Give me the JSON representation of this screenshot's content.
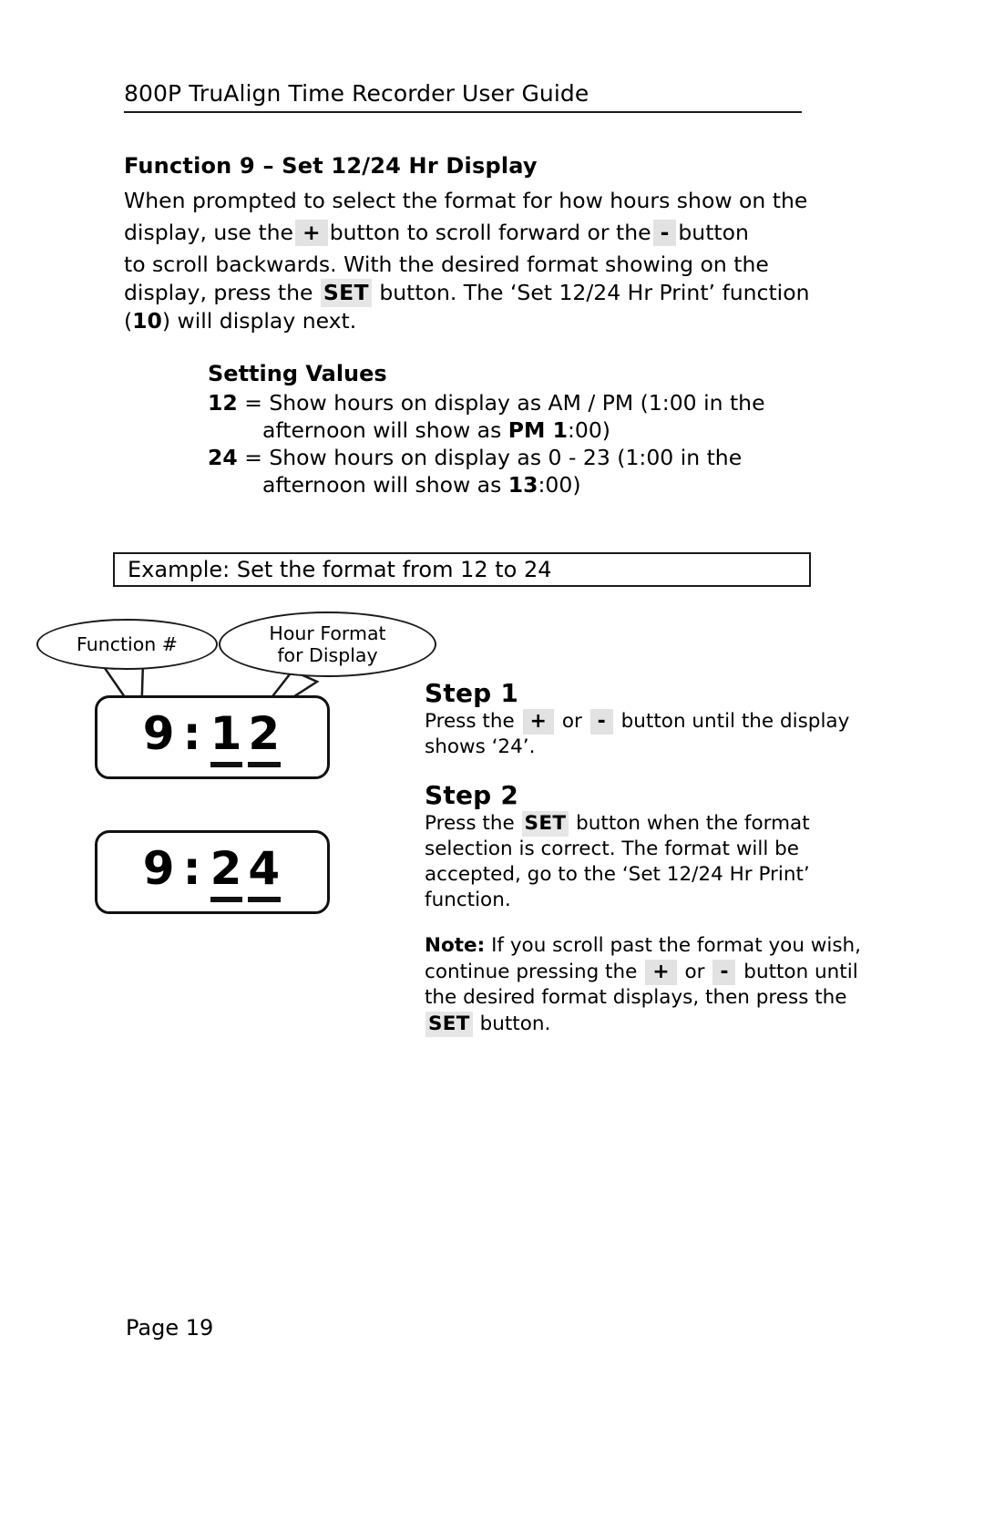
{
  "header": {
    "title": "800P TruAlign Time Recorder User Guide"
  },
  "function_section": {
    "heading": "Function 9 – Set 12/24 Hr Display",
    "intro_line1": "When prompted to select the format for how hours show on the",
    "intro_line2_a": "display, use the",
    "intro_key_plus": "+",
    "intro_line2_b": "button to scroll forward or the",
    "intro_key_minus": "-",
    "intro_line2_c": "button",
    "intro_line3": "to scroll backwards. With the desired format showing on the",
    "intro_line4_a": "display, press the",
    "intro_key_set": "SET",
    "intro_line4_b": "button. The ‘Set 12/24 Hr Print’ function",
    "intro_line5_a": "(",
    "intro_line5_num": "10",
    "intro_line5_b": ") will display next."
  },
  "setting_values": {
    "title": "Setting Values",
    "rows": [
      {
        "value": "12",
        "text": "= Show hours on display as AM / PM (1:00 in the",
        "cont_a": "afternoon will show as ",
        "cont_bold": "PM 1",
        "cont_b": ":00)"
      },
      {
        "value": "24",
        "text": "= Show hours on display as 0 - 23 (1:00 in the",
        "cont_a": "afternoon will show as ",
        "cont_bold": "13",
        "cont_b": ":00)"
      }
    ]
  },
  "example": {
    "label": "Example: Set the format from 12 to 24"
  },
  "callouts": {
    "function_number": "Function #",
    "hour_format_line1": "Hour Format",
    "hour_format_line2": "for Display"
  },
  "displays": [
    {
      "name": "display-before",
      "function_digit": "9",
      "separator": ":",
      "value_digit_1": "1",
      "value_digit_2": "2"
    },
    {
      "name": "display-after",
      "function_digit": "9",
      "separator": ":",
      "value_digit_1": "2",
      "value_digit_2": "4"
    }
  ],
  "steps": [
    {
      "heading": "Step 1",
      "line1_a": "Press the",
      "key1": "+",
      "line1_b": "or",
      "key2": "-",
      "line1_c": "button until the display",
      "line2": "shows ‘24’."
    },
    {
      "heading": "Step 2",
      "line1_a": "Press the",
      "key1": "SET",
      "line1_b": "button when the format",
      "line2": "selection is correct. The format will be",
      "line3": "accepted, go to the ‘Set 12/24 Hr Print’",
      "line4": "function."
    }
  ],
  "note": {
    "label": "Note:",
    "line1": "If you scroll past the format you wish,",
    "line2_a": "continue pressing the",
    "key_plus": "+",
    "line2_b": "or",
    "key_minus": "-",
    "line2_c": "button until",
    "line3": "the desired format displays, then press the",
    "line4_key": "SET",
    "line4_text": "button."
  },
  "footer": {
    "page_label": "Page 19"
  }
}
